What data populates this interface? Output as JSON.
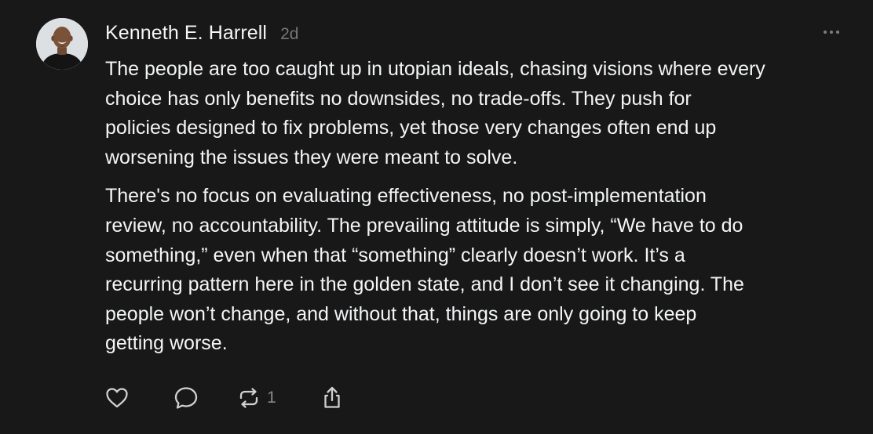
{
  "post": {
    "author": "Kenneth E. Harrell",
    "time": "2d",
    "paragraphs": [
      [
        "The people are too caught up in utopian ideals, chasing visions where every",
        "choice has only benefits no downsides, no trade-offs. They push for",
        "policies designed to fix problems, yet those very changes often end up",
        "worsening the issues they were meant to solve."
      ],
      [
        "There's no focus on evaluating effectiveness, no post-implementation",
        "review, no accountability. The prevailing attitude is simply, “We have to do",
        "something,” even when that “something” clearly doesn’t work. It’s a",
        "recurring pattern here in the golden state, and I don’t see it changing. The",
        "people won’t change, and without that, things are only going to keep",
        "getting worse."
      ]
    ],
    "actions": {
      "like_icon": "heart-icon",
      "reply_icon": "speech-bubble-icon",
      "repost_icon": "repost-icon",
      "repost_count": "1",
      "share_icon": "share-icon",
      "more_icon": "ellipsis-icon"
    }
  },
  "colors": {
    "background": "#181818",
    "text": "#f3f5f7",
    "secondary": "#777777"
  }
}
